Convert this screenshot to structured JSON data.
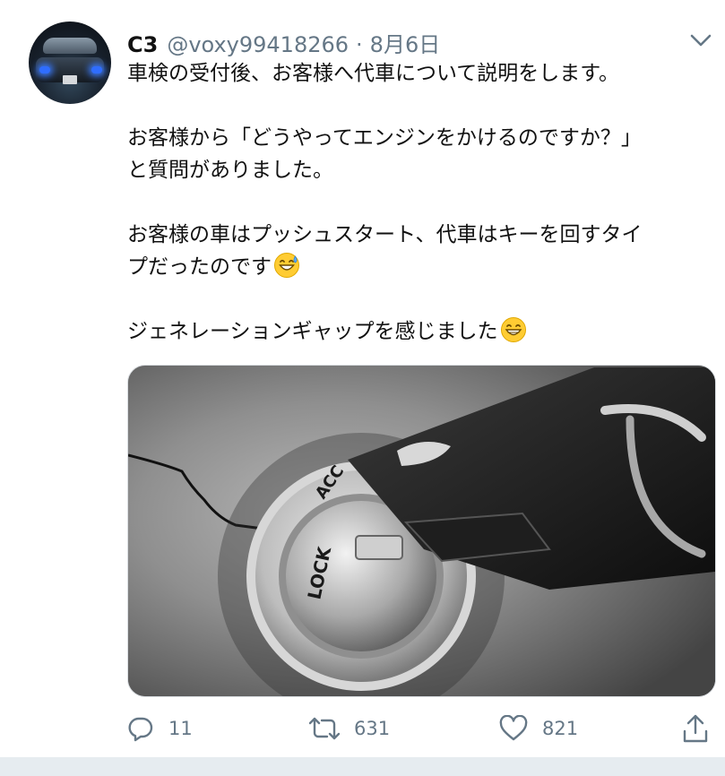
{
  "tweet": {
    "display_name": "C3",
    "handle": "@voxy99418266",
    "separator": "·",
    "date": "8月6日",
    "lines": [
      "車検の受付後、お客様へ代車について説明をします。",
      "",
      "お客様から「どうやってエンジンをかけるのですか？」",
      "と質問がありました。",
      "",
      "お客様の車はプッシュスタート、代車はキーを回すタイ",
      "プだったのです",
      "",
      "ジェネレーションギャップを感じました"
    ],
    "emojis": {
      "line7": "sweat-smile-emoji",
      "line9": "grin-emoji"
    }
  },
  "photo": {
    "labels": {
      "acc": "ACC",
      "lock": "LOCK"
    }
  },
  "actions": {
    "reply_count": "11",
    "retweet_count": "631",
    "like_count": "821"
  },
  "colors": {
    "text": "#111111",
    "muted": "#657786",
    "divider": "#e6ecf0"
  },
  "icons": {
    "caret": "chevron-down-icon",
    "reply": "reply-icon",
    "retweet": "retweet-icon",
    "like": "heart-icon",
    "share": "share-icon"
  }
}
